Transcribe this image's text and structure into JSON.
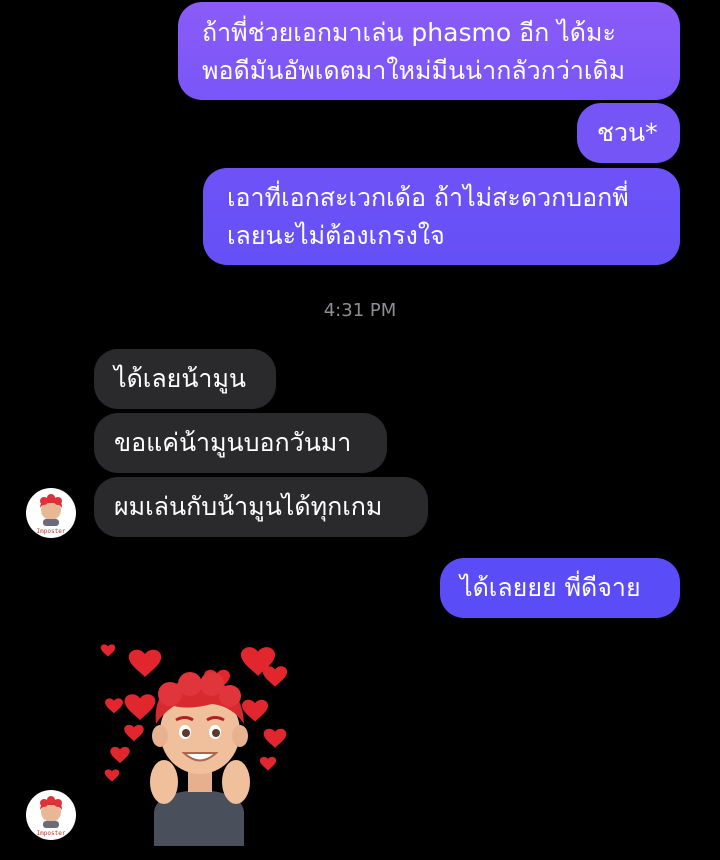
{
  "colors": {
    "background": "#000000",
    "outgoing_bubble_top": "#8556f8",
    "outgoing_bubble_bottom": "#5a4cf6",
    "incoming_bubble": "#2a2a2c",
    "timestamp": "#8e8e93"
  },
  "messages": {
    "out_1_line_1": "ถ้าพี่ช่วยเอกมาเล่น phasmo อีก ได้มะ",
    "out_1_line_2": "พอดีมันอัพเดตมาใหม่มีนน่ากลัวกว่าเดิม",
    "out_2": "ชวน*",
    "out_3_line_1": "เอาที่เอกสะเวกเด้อ ถ้าไม่สะดวกบอกพี่",
    "out_3_line_2": "เลยนะไม่ต้องเกรงใจ",
    "timestamp": "4:31 PM",
    "in_1": "ได้เลยน้ามูน",
    "in_2": "ขอแค่น้ามูนบอกวันมา",
    "in_3": "ผมเล่นกับน้ามูนได้ทุกเกม",
    "out_4": "ได้เลยยย พี่ดีจาย"
  },
  "avatar": {
    "caption": "Imposter",
    "icon": "red-haired-character-avatar-icon"
  },
  "sticker": {
    "icon": "memoji-with-hearts-sticker-icon"
  }
}
